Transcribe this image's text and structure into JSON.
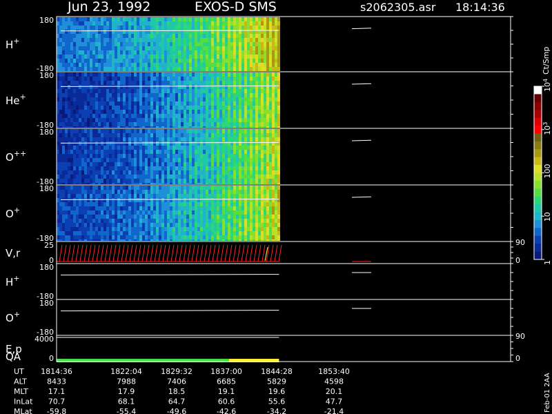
{
  "header": {
    "date": "Jun 23, 1992",
    "instrument": "EXOS-D SMS",
    "file": "s2062305.asr",
    "time": "18:14:36"
  },
  "footer_label": "Feb-01 2AA",
  "colors": {
    "background": "#000000",
    "frame": "#ffffff",
    "velocity_trace": "#ff2020",
    "qa_good": "#44dd44",
    "qa_fair": "#ffee33"
  },
  "chart_data": {
    "type": "heatmap",
    "panels": [
      {
        "id": "h-plus",
        "label": "H",
        "sup": "+",
        "ytop": "180",
        "ybot": "-180",
        "kind": "spectrogram",
        "intensity": 0.45
      },
      {
        "id": "he-plus",
        "label": "He",
        "sup": "+",
        "ytop": "180",
        "ybot": "-180",
        "kind": "spectrogram",
        "intensity": 0.2
      },
      {
        "id": "o-plus-plus",
        "label": "O",
        "sup": "++",
        "ytop": "180",
        "ybot": "-180",
        "kind": "spectrogram",
        "intensity": 0.22
      },
      {
        "id": "o-plus",
        "label": "O",
        "sup": "+",
        "ytop": "180",
        "ybot": "-180",
        "kind": "spectrogram",
        "intensity": 0.28
      },
      {
        "id": "v-r",
        "label": "V,r",
        "sup": "",
        "ytop": "25",
        "ybot": "0",
        "ytop_right": "90",
        "ybot_right": "0",
        "kind": "velocity"
      },
      {
        "id": "h-plus-2",
        "label": "H",
        "sup": "+",
        "ytop": "180",
        "ybot": "-180",
        "kind": "line"
      },
      {
        "id": "o-plus-2",
        "label": "O",
        "sup": "+",
        "ytop": "180",
        "ybot": "-180",
        "kind": "line"
      },
      {
        "id": "e-p",
        "label": "E,p",
        "sup": "",
        "label2": "QA",
        "ytop": "4000",
        "ybot": "0",
        "ytop_right": "90",
        "ybot_right": "0",
        "kind": "energy"
      }
    ],
    "colorbar": {
      "unit": "Ct/Smp",
      "ticks": [
        {
          "label": "1",
          "value": 1
        },
        {
          "label": "10",
          "value": 10
        },
        {
          "label": "100",
          "value": 100
        },
        {
          "label": "10",
          "sup": "3",
          "value": 1000
        },
        {
          "label": "10",
          "sup": "4",
          "value": 10000
        }
      ],
      "colors": [
        "#0a1a7a",
        "#0b2a9a",
        "#0b3fb3",
        "#1166cc",
        "#1f8fd9",
        "#22b3cc",
        "#1fc9a8",
        "#2ed67a",
        "#55dd44",
        "#88e02e",
        "#bbe02a",
        "#e0dd22",
        "#c8b818",
        "#a89a10",
        "#8a7c10",
        "#6e6010",
        "#ff0000",
        "#dd0000",
        "#aa0000",
        "#880000",
        "#660000",
        "#ffffff"
      ]
    },
    "time_axis": {
      "rows": [
        {
          "name": "UT",
          "values": [
            "1814:36",
            "1822:04",
            "1829:32",
            "1837:00",
            "1844:28",
            "1853:40"
          ]
        },
        {
          "name": "ALT",
          "values": [
            "8433",
            "7988",
            "7406",
            "6685",
            "5829",
            "4598"
          ]
        },
        {
          "name": "MLT",
          "values": [
            "17.1",
            "17.9",
            "18.5",
            "19.1",
            "19.6",
            "20.1"
          ]
        },
        {
          "name": "InLat",
          "values": [
            "70.7",
            "68.1",
            "64.7",
            "60.6",
            "55.6",
            "47.7"
          ]
        },
        {
          "name": "MLat",
          "values": [
            "-59.8",
            "-55.4",
            "-49.6",
            "-42.6",
            "-34.2",
            "-21.4"
          ]
        }
      ]
    },
    "data_coverage_end_fraction": 0.49,
    "qa_segments": [
      {
        "from": 0,
        "to": 0.38,
        "quality": "good"
      },
      {
        "from": 0.38,
        "to": 0.49,
        "quality": "fair"
      }
    ]
  }
}
